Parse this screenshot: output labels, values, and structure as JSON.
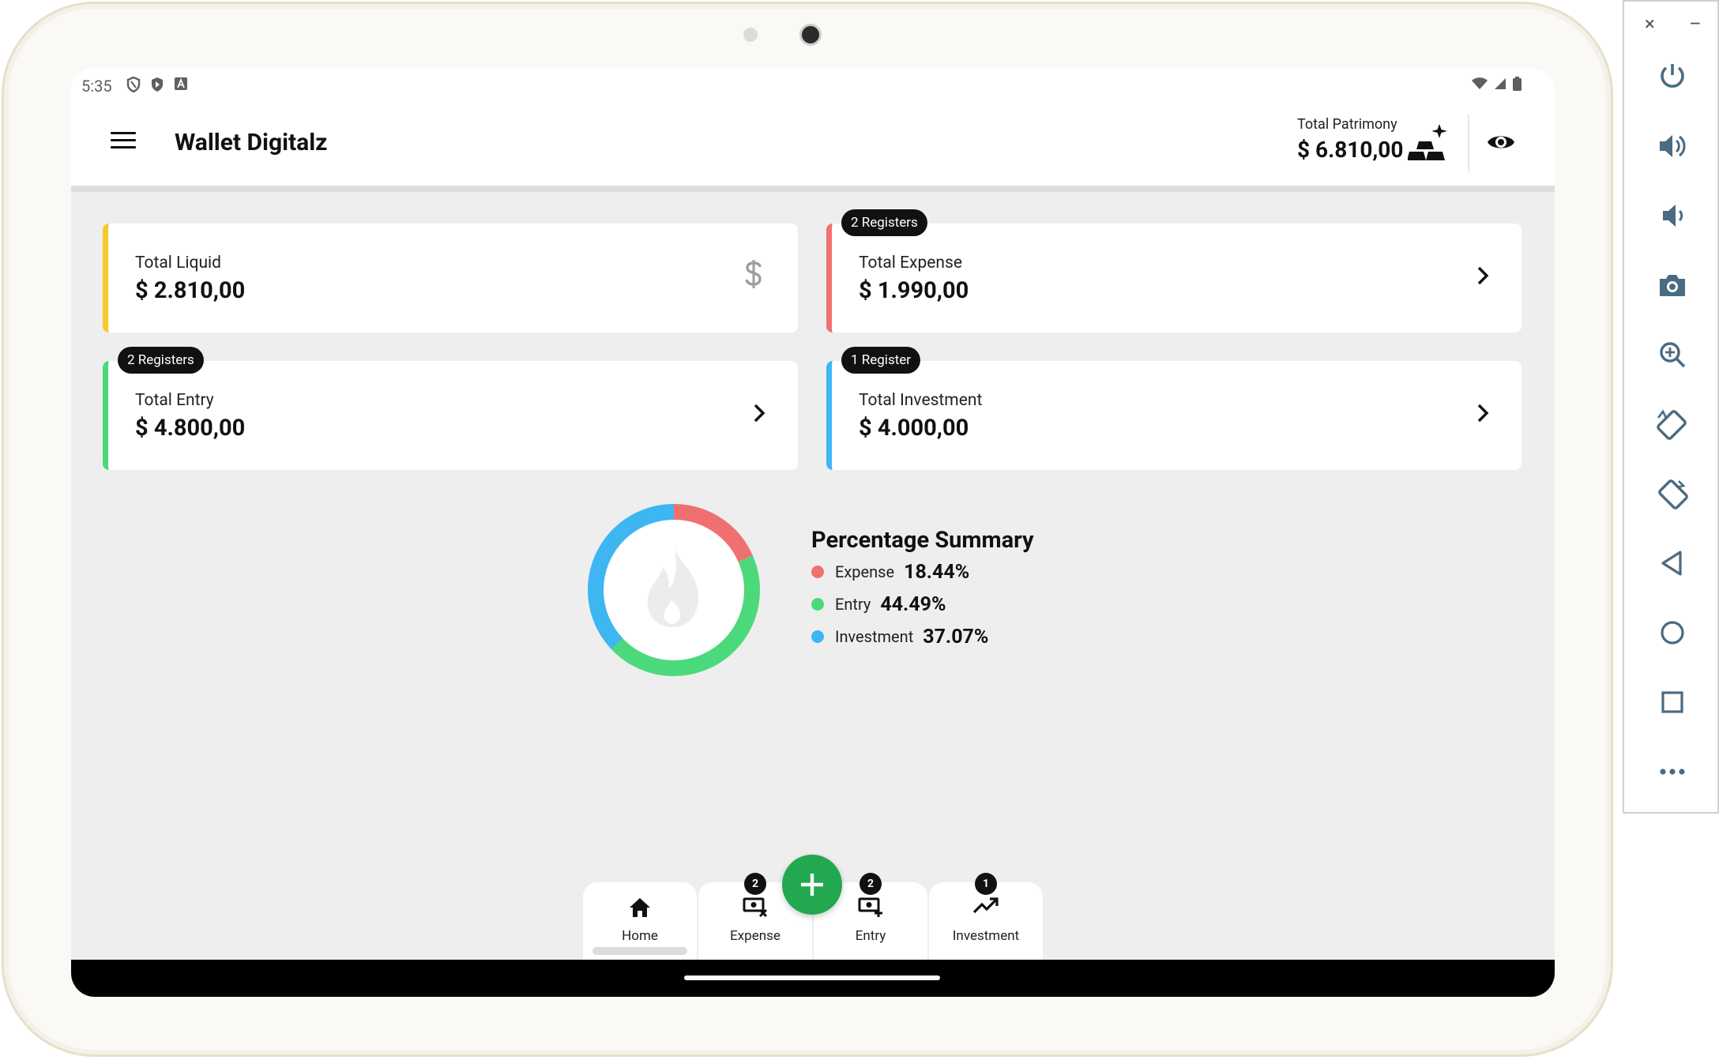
{
  "status_bar": {
    "time": "5:35"
  },
  "app_bar": {
    "title": "Wallet Digitalz",
    "patrimony_label": "Total Patrimony",
    "patrimony_value": "$ 6.810,00"
  },
  "cards": {
    "liquid": {
      "label": "Total Liquid",
      "value": "$ 2.810,00",
      "accent": "#f6c928"
    },
    "expense": {
      "label": "Total Expense",
      "value": "$ 1.990,00",
      "badge": "2 Registers",
      "accent": "#f07070"
    },
    "entry": {
      "label": "Total Entry",
      "value": "$ 4.800,00",
      "badge": "2 Registers",
      "accent": "#4cd97b"
    },
    "investment": {
      "label": "Total Investment",
      "value": "$ 4.000,00",
      "badge": "1 Register",
      "accent": "#3db6f2"
    }
  },
  "summary": {
    "title": "Percentage Summary",
    "items": [
      {
        "name": "Expense",
        "percent": "18.44%",
        "color": "#f07070"
      },
      {
        "name": "Entry",
        "percent": "44.49%",
        "color": "#4cd97b"
      },
      {
        "name": "Investment",
        "percent": "37.07%",
        "color": "#3db6f2"
      }
    ]
  },
  "bottom_nav": {
    "home": {
      "label": "Home"
    },
    "expense": {
      "label": "Expense",
      "count": "2"
    },
    "entry": {
      "label": "Entry",
      "count": "2"
    },
    "investment": {
      "label": "Investment",
      "count": "1"
    }
  },
  "emulator": {
    "close": "×",
    "minimize": "–"
  },
  "colors": {
    "fab": "#22a94f",
    "accent_dark": "#111111"
  }
}
